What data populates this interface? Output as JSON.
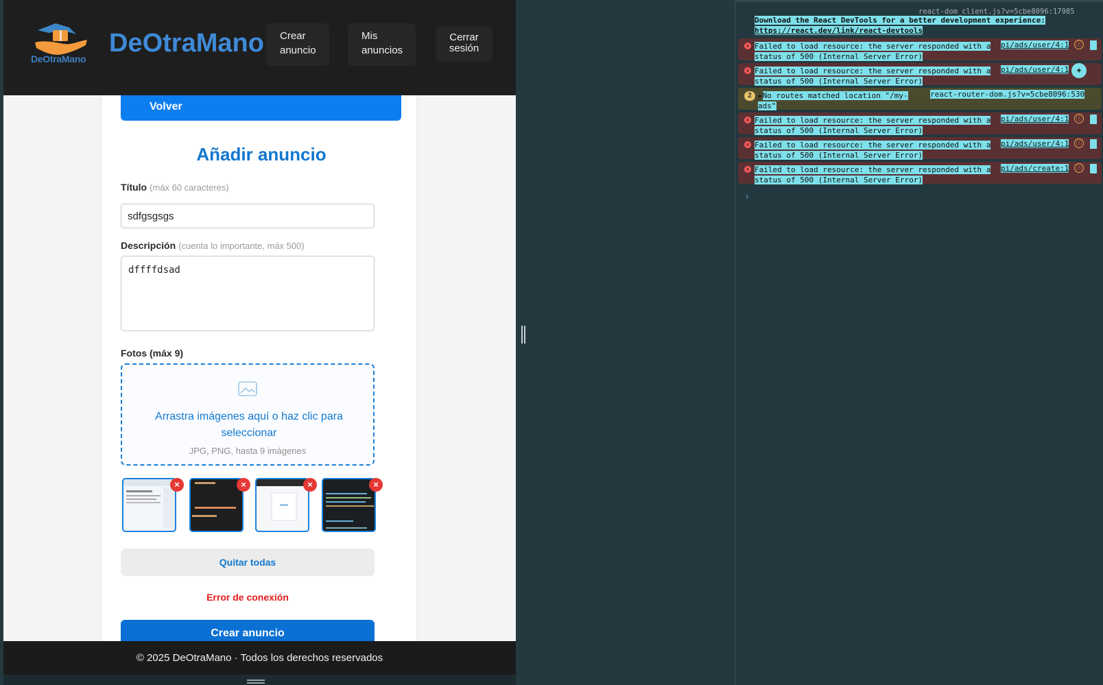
{
  "header": {
    "logo_text": "DeOtraMano",
    "brand": "DeOtraMano",
    "nav": {
      "crear": "Crear anuncio",
      "mis": "Mis anuncios",
      "cerrar": "Cerrar sesión"
    }
  },
  "form": {
    "back_label": "Volver",
    "title": "Añadir anuncio",
    "titulo_label": "Título",
    "titulo_hint": "(máx 60 caracteres)",
    "titulo_value": "sdfgsgsgs",
    "desc_label": "Descripción",
    "desc_hint": "(cuenta lo importante, máx 500)",
    "desc_value": "dffffdsad",
    "fotos_label": "Fotos (máx 9)",
    "drop_text": "Arrastra imágenes aquí o haz clic para seleccionar",
    "drop_sub": "JPG, PNG, hasta 9 imágenes",
    "remove_symbol": "×",
    "quitar_label": "Quitar todas",
    "error_text": "Error de conexión",
    "submit_label": "Crear anuncio"
  },
  "footer": {
    "text": "© 2025 DeOtraMano · Todos los derechos reservados"
  },
  "console": {
    "top_source": "react-dom_client.js?v=5cbe8096:17985",
    "info_line1": "Download the React DevTools for a better development experience:",
    "info_line2": "https://react.dev/link/react-devtools",
    "messages": [
      {
        "line1": "Failed to load resource: the server responded with a",
        "line2": "status of 500 (Internal Server Error)",
        "source": "pi/ads/user/4:1"
      },
      {
        "line1": "Failed to load resource: the server responded with a",
        "line2": "status of 500 (Internal Server Error)",
        "source": "pi/ads/user/4:1"
      },
      {
        "line1": "Failed to load resource: the server responded with a",
        "line2": "status of 500 (Internal Server Error)",
        "source": "pi/ads/user/4:1"
      },
      {
        "line1": "Failed to load resource: the server responded with a",
        "line2": "status of 500 (Internal Server Error)",
        "source": "pi/ads/user/4:1"
      },
      {
        "line1": "Failed to load resource: the server responded with a",
        "line2": "status of 500 (Internal Server Error)",
        "source": "pi/ads/create:1"
      }
    ],
    "warning": {
      "count": "2",
      "line1": "No routes matched location \"/my-",
      "line2": "ads\"",
      "source": "react-router-dom.js?v=5cbe8096:530"
    },
    "prompt": "›"
  },
  "colors": {
    "brand_blue": "#3f8ad7",
    "primary_button": "#0a70d4",
    "error_red": "#e11b1b",
    "header_bg": "#1e1e1e",
    "console_bg": "#23383e",
    "highlight": "#7ee0ea"
  }
}
